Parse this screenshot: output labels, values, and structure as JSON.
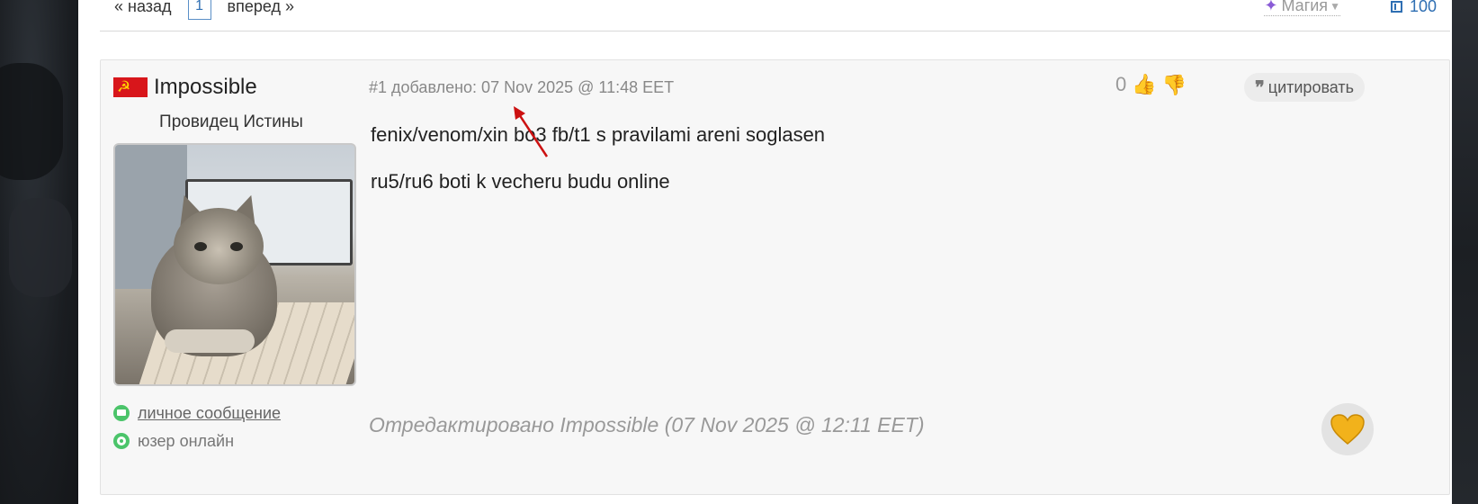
{
  "pagination": {
    "prev_label": "« назад",
    "current_page": "1",
    "next_label": "вперед »"
  },
  "topbar": {
    "magic_label": "Магия",
    "count": "100"
  },
  "post": {
    "author": {
      "name": "Impossible",
      "rank": "Провидец Истины",
      "pm_label": "личное сообщение",
      "status_label": "юзер онлайн"
    },
    "meta": "#1 добавлено: 07 Nov 2025 @ 11:48 EET",
    "body": [
      "fenix/venom/xin bo3 fb/t1 s pravilami areni soglasen",
      "ru5/ru6 boti k vecheru budu online"
    ],
    "rating": "0",
    "quote_label": "цитировать",
    "edited": "Отредактировано Impossible (07 Nov 2025 @ 12:11 EET)"
  },
  "colors": {
    "accent": "#2f6fb3",
    "online_green": "#4bc46a",
    "flag_red": "#d8161b",
    "annotation_red": "#cc1111",
    "heart_gold": "#f2b21b"
  }
}
